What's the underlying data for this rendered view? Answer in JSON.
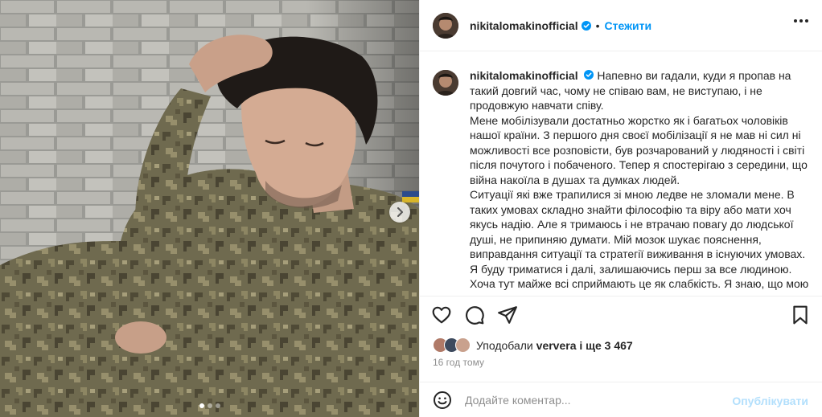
{
  "post": {
    "username": "nikitalomakinofficial",
    "separator": "•",
    "follow_label": "Стежити",
    "media_image": "soldier-photo",
    "carousel_dots": 3,
    "carousel_active_dot": 1
  },
  "caption": {
    "username": "nikitalomakinofficial",
    "paragraphs": [
      "Напевно ви гадали, куди я пропав на такий довгий час, чому не співаю вам, не виступаю, і не продовжую навчати співу.",
      "Мене мобілізували достатньо жорстко як і багатьох чоловіків нашої країни. З першого дня своєї мобілізації я не мав ні сил ні можливості все розповісти, був розчарований у людяності і світі після почутого і побаченого. Тепер я спостерігаю з середини, що війна накоїла в душах та думках людей.",
      "Ситуації які вже трапилися зі мною ледве не зломали мене. В таких умовах складно знайти філософію та віру або мати хоч якусь надію. Але я тримаюсь і не втрачаю повагу до людської душі, не припиняю думати. Мій мозок шукає пояснення, виправдання ситуації та стратегії виживання в існуючих умовах. Я буду триматися і далі, залишаючись перш за все людиною. Хоча тут майже всі сприймають це як слабкість. Я знаю, що мою"
    ]
  },
  "likes": {
    "prefix": "Уподобали",
    "user": "ververa",
    "suffix": "і ще 3 467"
  },
  "timestamp": "16 год тому",
  "comment": {
    "placeholder": "Додайте коментар...",
    "publish_label": "Опублікувати"
  },
  "colors": {
    "accent": "#0095f6",
    "publish_disabled": "#b2dffc",
    "text": "#262626",
    "muted": "#8e8e8e",
    "border": "#efefef"
  },
  "icons": [
    "heart-icon",
    "comment-icon",
    "share-icon",
    "bookmark-icon",
    "more-options-icon",
    "verified-icon",
    "emoji-icon",
    "chevron-right-icon"
  ]
}
